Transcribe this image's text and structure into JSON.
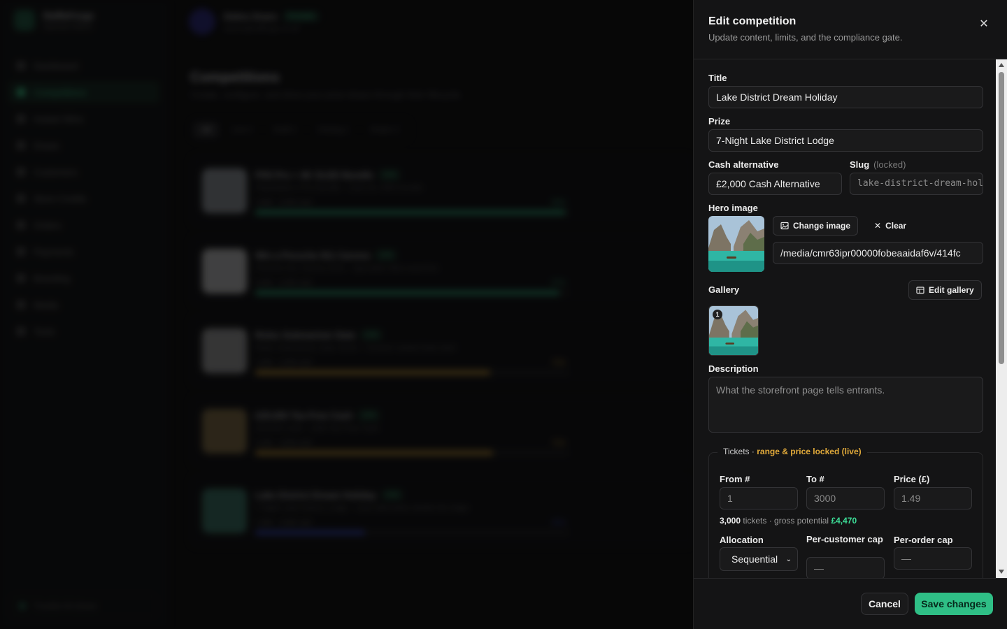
{
  "background": {
    "brand": {
      "name": "RaffleForge",
      "sub": "Operator Admin"
    },
    "nav": [
      {
        "label": "Dashboard",
        "active": false
      },
      {
        "label": "Competitions",
        "active": true
      },
      {
        "label": "Instant Wins",
        "active": false
      },
      {
        "label": "Draws",
        "active": false
      },
      {
        "label": "Customers",
        "active": false
      },
      {
        "label": "Store Credits",
        "active": false
      },
      {
        "label": "Orders",
        "active": false
      },
      {
        "label": "Payments",
        "active": false
      },
      {
        "label": "Branding",
        "active": false
      },
      {
        "label": "Media",
        "active": false
      },
      {
        "label": "Tools",
        "active": false
      }
    ],
    "footer": "Trouble-hit draws",
    "user": {
      "name": "Debra Snare",
      "role": "Founder",
      "email": "admin@rafforge.co.uk"
    },
    "page_title": "Competitions",
    "page_sub": "Create, configure, and drive your prize draws through their lifecycle.",
    "filters": [
      {
        "label": "All",
        "on": true
      },
      {
        "label": "Live 4",
        "on": false
      },
      {
        "label": "Draft 2",
        "on": false
      },
      {
        "label": "Closing 1",
        "on": false
      },
      {
        "label": "Drawn 3",
        "on": false
      }
    ],
    "competitions": [
      {
        "title": "PS5 Pro + 4K OLED Bundle",
        "badge": "Live",
        "sub": "PlayStation 5 Pro Bundle · Cash alt. £650 bundle",
        "count": "2,980 · 3,000 sold",
        "pct": "99%",
        "progress": 0.99,
        "color": "#2fbf86",
        "thumb": "#9aa0a6"
      },
      {
        "title": "Win a Porsche 911 Carrera",
        "badge": "Live",
        "sub": "Porsche 911 Carrera 2024 · Specialist, Best searches",
        "count": "3,000 · 3,000 sold",
        "pct": "97%",
        "progress": 0.97,
        "color": "#2fbf86",
        "thumb": "#cfcfcf"
      },
      {
        "title": "Rolex Submariner Date",
        "badge": "Live",
        "sub": "Rolex Submariner Date 41mm · Ceramic sealed Date steel",
        "count": "1,500 · 2,000 sold",
        "pct": "75%",
        "progress": 0.75,
        "color": "#e0a93a",
        "thumb": "#a8a8a8"
      },
      {
        "title": "£25,000 Tax-Free Cash",
        "badge": "Live",
        "sub": "£25,000 Cash · 100k Tax-Free Cash",
        "count": "2,200 · 3,000 sold",
        "pct": "76%",
        "progress": 0.76,
        "color": "#e0a93a",
        "thumb": "#8a7448"
      },
      {
        "title": "Lake District Dream Holiday",
        "badge": "Live",
        "sub": "7-Night Lake District Lodge · Cash alternative details the lodge",
        "count": "1,050 · 3,000 sold",
        "pct": "35%",
        "progress": 0.35,
        "color": "#3b4fd8",
        "thumb": "#3c7a6a"
      }
    ]
  },
  "drawer": {
    "title": "Edit competition",
    "subtitle": "Update content, limits, and the compliance gate.",
    "close_icon": "close-icon",
    "fields": {
      "title_label": "Title",
      "title_value": "Lake District Dream Holiday",
      "prize_label": "Prize",
      "prize_value": "7-Night Lake District Lodge",
      "cash_label": "Cash alternative",
      "cash_value": "£2,000 Cash Alternative",
      "slug_label": "Slug",
      "slug_note": "(locked)",
      "slug_value": "lake-district-dream-holiday",
      "hero_label": "Hero image",
      "change_image": "Change image",
      "clear": "Clear",
      "hero_path": "/media/cmr63ipr00000fobeaaidaf6v/414fc",
      "gallery_label": "Gallery",
      "edit_gallery": "Edit gallery",
      "gallery_count": "1",
      "description_label": "Description",
      "description_placeholder": "What the storefront page tells entrants."
    },
    "tickets": {
      "legend": "Tickets ·",
      "legend_warn": "range & price locked (live)",
      "from_label": "From #",
      "from_value": "1",
      "to_label": "To #",
      "to_value": "3000",
      "price_label": "Price (£)",
      "price_value": "1.49",
      "count": "3,000",
      "count_suffix": "tickets · gross potential",
      "potential": "£4,470",
      "allocation_label": "Allocation",
      "allocation_value": "Sequential",
      "per_customer_label": "Per-customer cap",
      "per_customer_value": "—",
      "per_order_label": "Per-order cap",
      "per_order_value": "—"
    },
    "footer": {
      "cancel": "Cancel",
      "save": "Save changes"
    },
    "colors": {
      "accent": "#2fbf86",
      "warn": "#e0a93a",
      "panel": "#141415"
    }
  }
}
